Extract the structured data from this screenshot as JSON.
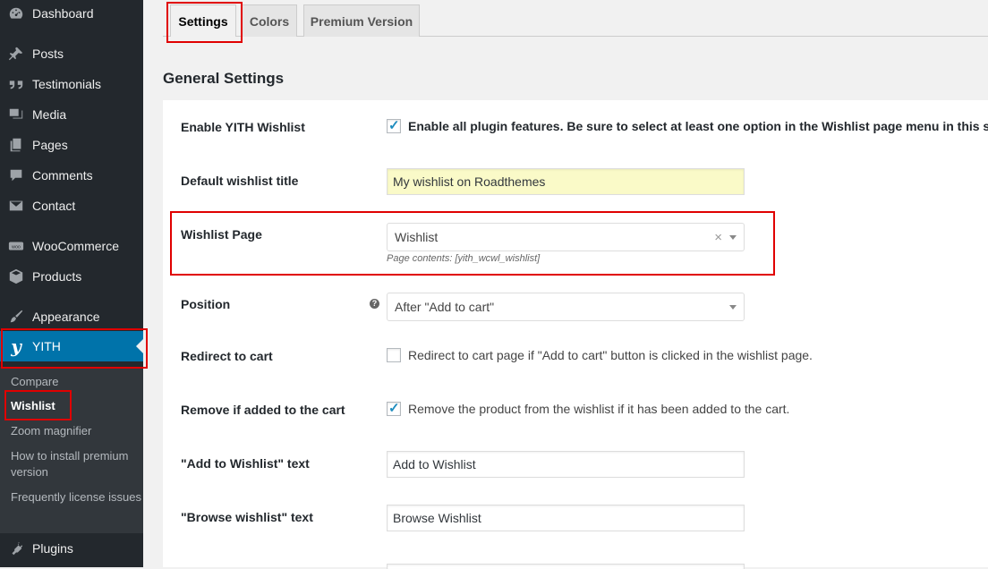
{
  "sidebar": {
    "items": [
      {
        "label": "Dashboard",
        "icon": "dashboard-icon"
      },
      {
        "label": "Posts",
        "icon": "pin-icon"
      },
      {
        "label": "Testimonials",
        "icon": "quote-icon"
      },
      {
        "label": "Media",
        "icon": "media-icon"
      },
      {
        "label": "Pages",
        "icon": "pages-icon"
      },
      {
        "label": "Comments",
        "icon": "comment-icon"
      },
      {
        "label": "Contact",
        "icon": "mail-icon"
      },
      {
        "label": "WooCommerce",
        "icon": "woocommerce-icon"
      },
      {
        "label": "Products",
        "icon": "box-icon"
      },
      {
        "label": "Appearance",
        "icon": "brush-icon"
      },
      {
        "label": "YITH",
        "icon": "yith-logo-icon"
      },
      {
        "label": "Plugins",
        "icon": "plug-icon"
      }
    ],
    "submenu": [
      {
        "label": "Compare"
      },
      {
        "label": "Wishlist"
      },
      {
        "label": "Zoom magnifier"
      },
      {
        "label": "How to install premium version"
      },
      {
        "label": "Frequently license issues"
      }
    ],
    "yith_logo_text": "y"
  },
  "tabs": [
    {
      "label": "Settings"
    },
    {
      "label": "Colors"
    },
    {
      "label": "Premium Version"
    }
  ],
  "section_title": "General Settings",
  "settings": {
    "enable": {
      "label": "Enable YITH Wishlist",
      "checked": true,
      "text_bold": "Enable all plugin features. Be sure to select at least one option in the Wishlist page menu in this setting"
    },
    "default_title": {
      "label": "Default wishlist title",
      "value": "My wishlist on Roadthemes"
    },
    "wishlist_page": {
      "label": "Wishlist Page",
      "value": "Wishlist",
      "clear": "×",
      "description": "Page contents: [yith_wcwl_wishlist]"
    },
    "position": {
      "label": "Position",
      "value": "After \"Add to cart\"",
      "help": "?"
    },
    "redirect": {
      "label": "Redirect to cart",
      "checked": false,
      "text": "Redirect to cart page if \"Add to cart\" button is clicked in the wishlist page."
    },
    "remove": {
      "label": "Remove if added to the cart",
      "checked": true,
      "text": "Remove the product from the wishlist if it has been added to the cart."
    },
    "add_text": {
      "label": "\"Add to Wishlist\" text",
      "value": "Add to Wishlist"
    },
    "browse_text": {
      "label": "\"Browse wishlist\" text",
      "value": "Browse Wishlist"
    }
  },
  "checkmark": "✓",
  "colors": {
    "sidebar_bg": "#23282d",
    "submenu_bg": "#32373c",
    "active_blue": "#0073aa",
    "highlight_red": "#e00000",
    "checkbox_blue": "#1e8cbe"
  }
}
